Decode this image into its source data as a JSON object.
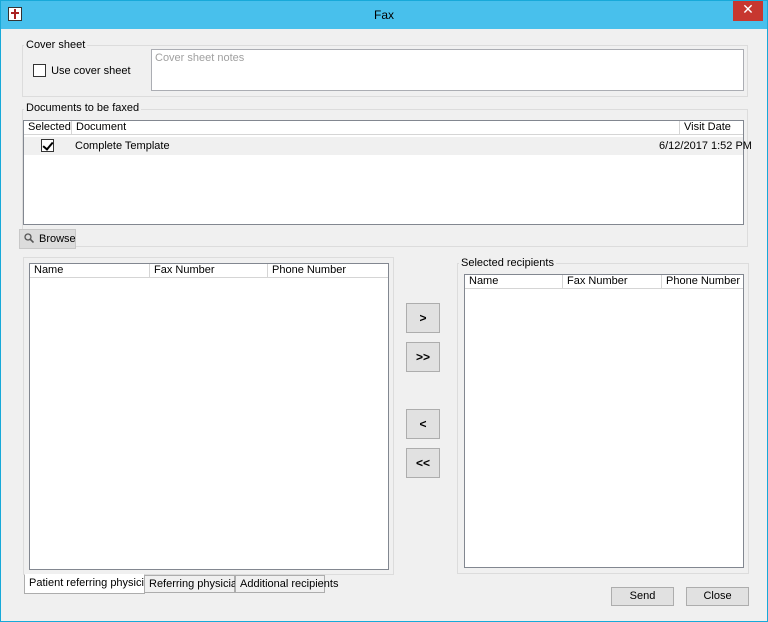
{
  "window": {
    "title": "Fax",
    "close_glyph": "✕"
  },
  "cover_sheet": {
    "group_label": "Cover sheet",
    "use_cover_sheet_label": "Use cover sheet",
    "notes_placeholder": "Cover sheet notes"
  },
  "documents": {
    "group_label": "Documents to be faxed",
    "columns": {
      "selected": "Selected",
      "document": "Document",
      "visit_date": "Visit Date"
    },
    "rows": [
      {
        "selected": true,
        "document": "Complete Template",
        "visit_date": "6/12/2017 1:52 PM"
      }
    ],
    "browse_label": "Browse"
  },
  "available": {
    "columns": {
      "name": "Name",
      "fax": "Fax Number",
      "phone": "Phone Number"
    },
    "tabs": [
      "Patient referring physicians",
      "Referring physicians",
      "Additional recipients"
    ],
    "active_tab": 0
  },
  "transfer_buttons": {
    "add": ">",
    "add_all": ">>",
    "remove": "<",
    "remove_all": "<<"
  },
  "selected_recipients": {
    "group_label": "Selected recipients",
    "columns": {
      "name": "Name",
      "fax": "Fax Number",
      "phone": "Phone Number"
    }
  },
  "footer": {
    "send_label": "Send",
    "close_label": "Close"
  }
}
